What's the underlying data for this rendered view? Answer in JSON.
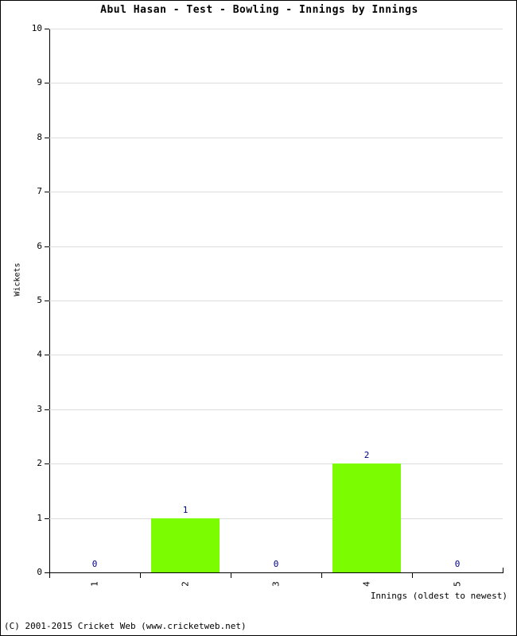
{
  "chart_data": {
    "type": "bar",
    "title": "Abul Hasan - Test - Bowling - Innings by Innings",
    "xlabel": "Innings (oldest to newest)",
    "ylabel": "Wickets",
    "categories": [
      "1",
      "2",
      "3",
      "4",
      "5"
    ],
    "values": [
      0,
      1,
      0,
      2,
      0
    ],
    "value_labels": [
      "0",
      "1",
      "0",
      "2",
      "0"
    ],
    "ylim": [
      0,
      10
    ],
    "ytick_labels": [
      "0",
      "1",
      "2",
      "3",
      "4",
      "5",
      "6",
      "7",
      "8",
      "9",
      "10"
    ],
    "ytick_values": [
      0,
      1,
      2,
      3,
      4,
      5,
      6,
      7,
      8,
      9,
      10
    ],
    "grid": true,
    "legend": "none",
    "series": [
      {
        "name": "Wickets",
        "values": [
          0,
          1,
          0,
          2,
          0
        ]
      }
    ],
    "colors": {
      "bar": "#7CFC00",
      "value_label": "#000080",
      "gridline": "#DCDCDC",
      "axis": "#000000",
      "background": "#FFFFFF"
    }
  },
  "footer": {
    "copyright": "(C) 2001-2015 Cricket Web (www.cricketweb.net)"
  }
}
